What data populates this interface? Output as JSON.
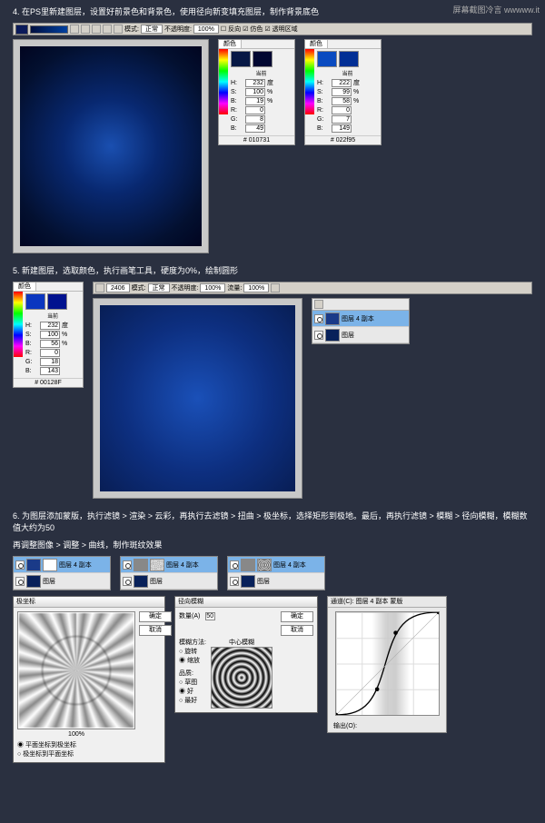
{
  "watermark": "屏幕截图冷言 wwwww.it",
  "step4": {
    "title": "4. 在PS里新建图层，设置好前景色和背景色，使用径向新变填充图层，制作背景底色",
    "toolbar": {
      "mode_label": "模式:",
      "mode": "正常",
      "opacity_label": "不透明度:",
      "opacity": "100%",
      "reverse": "反向",
      "dither": "仿色",
      "trans": "透明区域"
    },
    "picker1": {
      "tab": "颜色",
      "current": "当前",
      "h": "232",
      "s": "100",
      "b": "19",
      "r": "0",
      "g": "8",
      "bb": "49",
      "hex": "# 010731",
      "unit_deg": "度",
      "unit_pct": "%"
    },
    "picker2": {
      "tab": "颜色",
      "current": "当前",
      "h": "222",
      "s": "99",
      "b": "58",
      "r": "0",
      "g": "7",
      "bb": "149",
      "hex": "# 022f95"
    }
  },
  "step5": {
    "title": "5. 新建图层，选取颜色，执行画笔工具，硬度为0%，绘制圆形",
    "toolbar": {
      "size": "2406",
      "mode_label": "模式:",
      "mode": "正常",
      "opacity_label": "不透明度:",
      "opacity": "100%",
      "flow_label": "流量:",
      "flow": "100%"
    },
    "picker": {
      "tab": "颜色",
      "current": "当前",
      "h": "232",
      "s": "100",
      "b": "56",
      "r": "0",
      "g": "18",
      "bb": "143",
      "hex": "# 00128F"
    },
    "layers": {
      "r1": "图层 4 副本",
      "r2": "图层"
    }
  },
  "step6": {
    "title": "6. 为图层添加蒙版，执行滤镜 > 渲染 > 云彩，再执行去滤镜 > 扭曲 > 极坐标，选择矩形到极地。最后，再执行滤镜 > 模糊 > 径向模糊，模糊数值大约为50",
    "title2": "再调整图像 > 调整 > 曲线，制作斑纹效果",
    "layers": {
      "r1": "图层 4 副本",
      "r2": "图层"
    },
    "polar": {
      "title": "极坐标",
      "ok": "确定",
      "cancel": "取消",
      "zoom": "100%",
      "opt1": "平面坐标到极坐标",
      "opt2": "极坐标到平面坐标"
    },
    "radial": {
      "title": "径向模糊",
      "amount_label": "数量(A)",
      "amount": "50",
      "ok": "确定",
      "cancel": "取消",
      "method": "模糊方法:",
      "m1": "旋转",
      "m2": "缩放",
      "quality": "品质:",
      "q1": "草图",
      "q2": "好",
      "q3": "最好",
      "center": "中心模糊"
    },
    "curves": {
      "title": "通道(C): 图层 4 副本 蒙版",
      "output": "输出(O):"
    }
  },
  "labels": {
    "H": "H:",
    "S": "S:",
    "B": "B:",
    "R": "R:",
    "G": "G:",
    "Bb": "B:"
  },
  "chart_data": null
}
